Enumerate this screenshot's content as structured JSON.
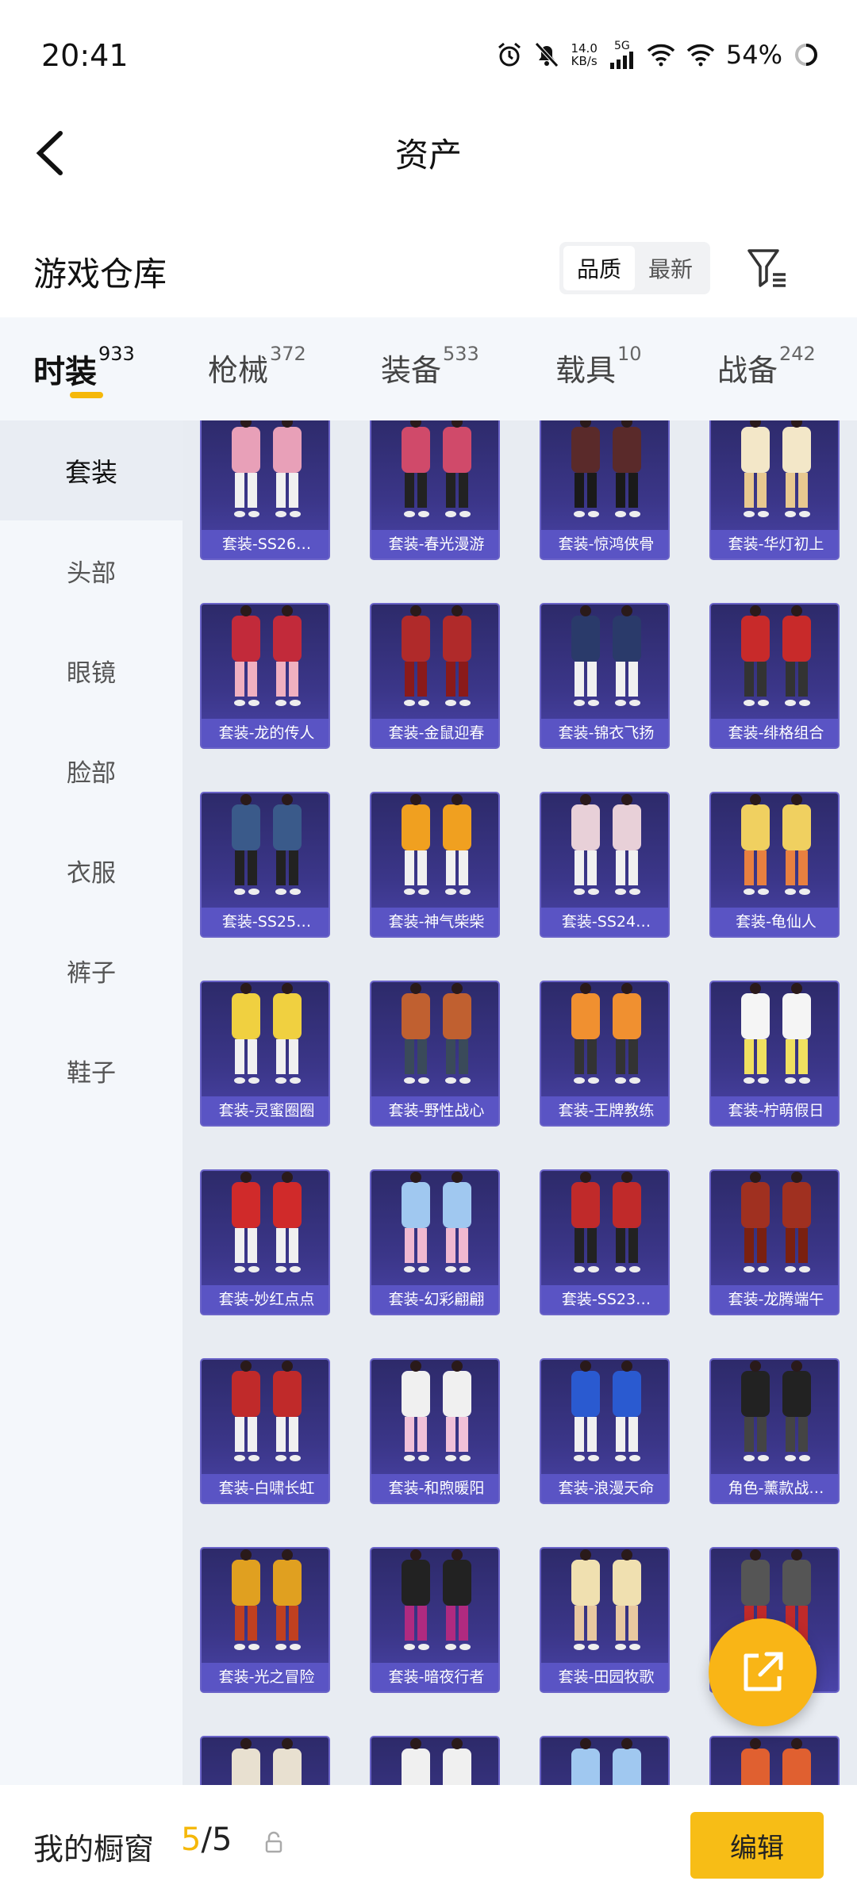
{
  "status": {
    "time": "20:41",
    "speed_top": "14.0",
    "speed_unit": "KB/s",
    "network": "5G",
    "battery": "54%"
  },
  "nav": {
    "title": "资产"
  },
  "warehouse": {
    "title": "游戏仓库",
    "sort_quality": "品质",
    "sort_latest": "最新"
  },
  "tabs": [
    {
      "label": "时装",
      "count": "933"
    },
    {
      "label": "枪械",
      "count": "372"
    },
    {
      "label": "装备",
      "count": "533"
    },
    {
      "label": "载具",
      "count": "10"
    },
    {
      "label": "战备",
      "count": "242"
    }
  ],
  "sidebar": [
    "套装",
    "头部",
    "眼镜",
    "脸部",
    "衣服",
    "裤子",
    "鞋子"
  ],
  "items": [
    "套装-SS26…",
    "套装-春光漫游",
    "套装-惊鸿侠骨",
    "套装-华灯初上",
    "套装-龙的传人",
    "套装-金鼠迎春",
    "套装-锦衣飞扬",
    "套装-绯格组合",
    "套装-SS25…",
    "套装-神气柴柴",
    "套装-SS24…",
    "套装-龟仙人",
    "套装-灵蜜圈圈",
    "套装-野性战心",
    "套装-王牌教练",
    "套装-柠萌假日",
    "套装-妙红点点",
    "套装-幻彩翩翩",
    "套装-SS23…",
    "套装-龙腾端午",
    "套装-白啸长虹",
    "套装-和煦暖阳",
    "套装-浪漫天命",
    "角色-薰款战…",
    "套装-光之冒险",
    "套装-暗夜行者",
    "套装-田园牧歌",
    "",
    "",
    "",
    "",
    ""
  ],
  "bottom": {
    "title": "我的橱窗",
    "current": "5",
    "separator": "/",
    "total": "5",
    "edit_label": "编辑"
  },
  "colors": {
    "accent": "#f5b80a",
    "card_bg": "#3b3689",
    "label_bg": "#5a54c4"
  }
}
